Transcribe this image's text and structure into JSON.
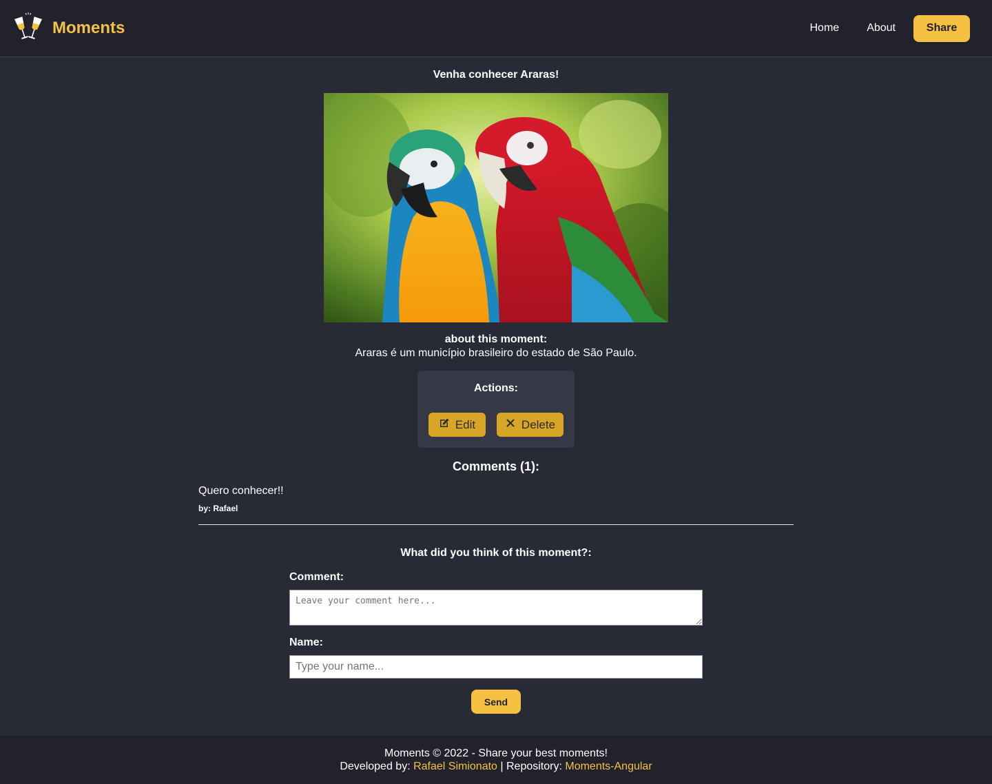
{
  "header": {
    "brand_name": "Moments",
    "logo_icon": "champagne-toast-icon",
    "nav": {
      "home": "Home",
      "about": "About",
      "share": "Share"
    }
  },
  "moment": {
    "title": "Venha conhecer Araras!",
    "image_alt": "macaw-parrots-photo",
    "about_label": "about this moment:",
    "description": "Araras é um município brasileiro do estado de São Paulo."
  },
  "actions": {
    "title": "Actions:",
    "edit_label": "Edit",
    "edit_icon": "edit-icon",
    "delete_label": "Delete",
    "delete_icon": "close-icon"
  },
  "comments": {
    "title": "Comments (1):",
    "items": [
      {
        "text": "Quero conhecer!!",
        "author": "by: Rafael"
      }
    ]
  },
  "form": {
    "title": "What did you think of this moment?:",
    "comment_label": "Comment:",
    "comment_placeholder": "Leave your comment here...",
    "name_label": "Name:",
    "name_placeholder": "Type your name...",
    "send_label": "Send"
  },
  "footer": {
    "line1": "Moments © 2022 - Share your best moments!",
    "developed_by_label": "Developed by:",
    "developer_name": "Rafael Simionato",
    "separator": "|",
    "repository_label": "Repository:",
    "repository_name": "Moments-Angular"
  },
  "colors": {
    "accent": "#f6c043",
    "background": "#282a36",
    "header_bg": "#21222c",
    "action_button": "#d9a526",
    "panel": "#363847"
  }
}
